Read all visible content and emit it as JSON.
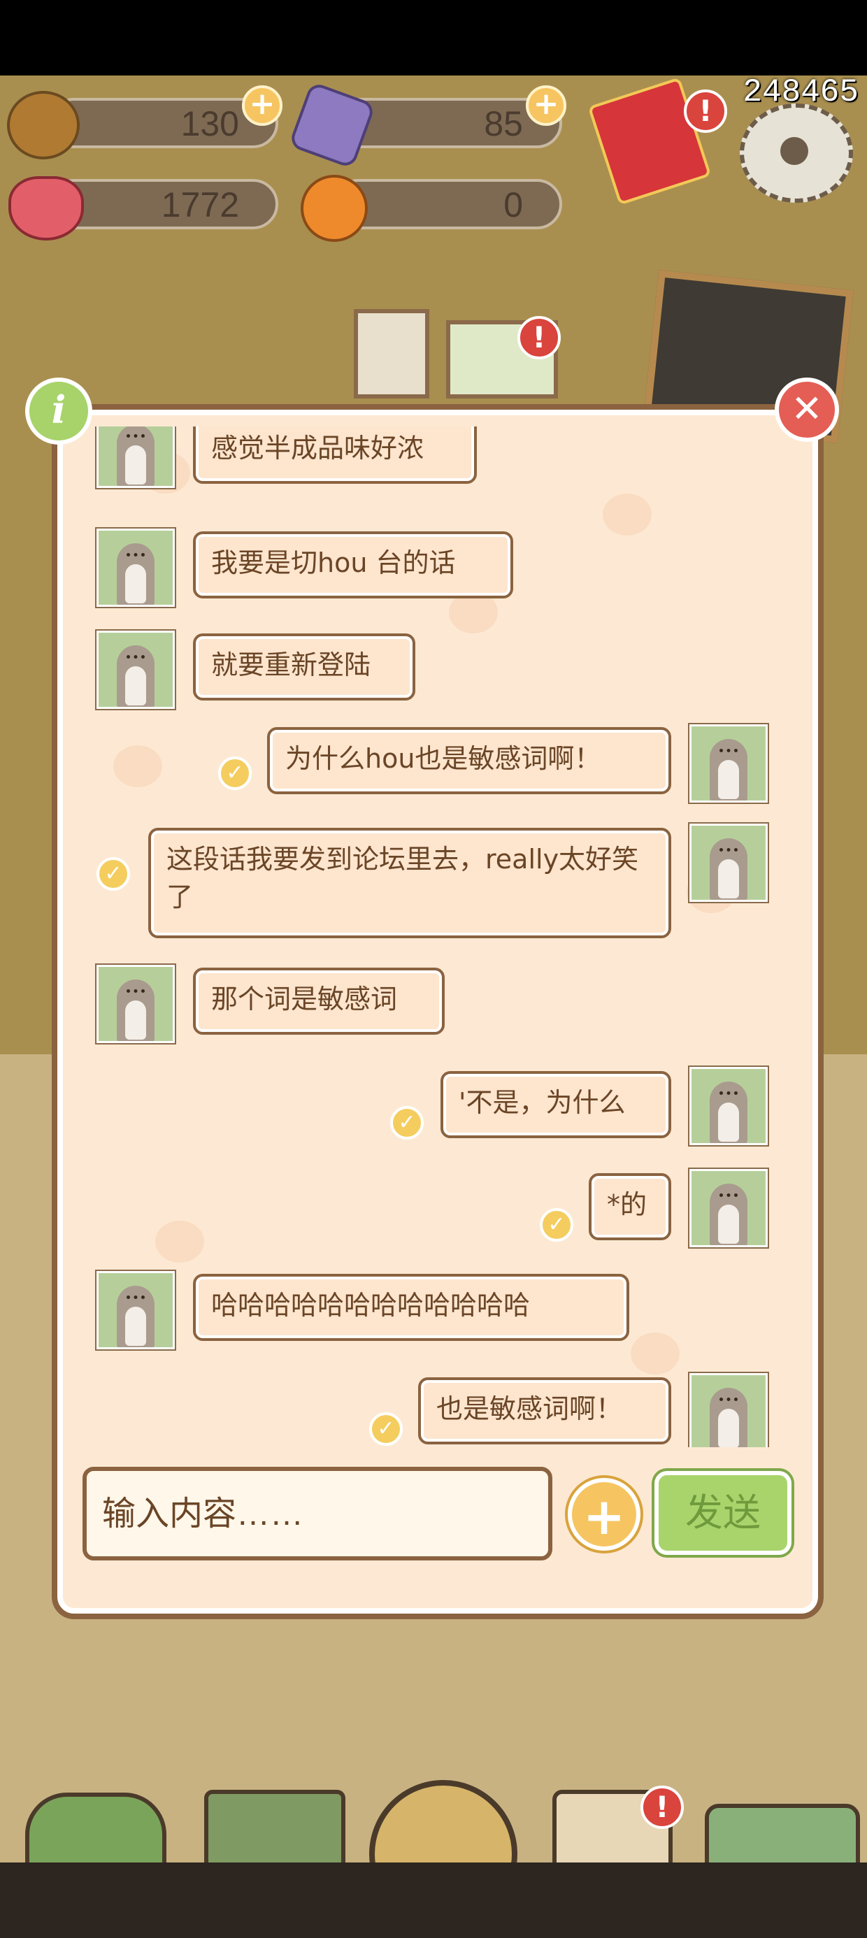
{
  "hud": {
    "acorn": "130",
    "gem": "85",
    "heart": "1772",
    "orange": "0",
    "score": "248465"
  },
  "chat": {
    "messages": [
      {
        "side": "left",
        "text": "感觉半成品味好浓",
        "read": false
      },
      {
        "side": "left",
        "text": "我要是切hou 台的话",
        "read": false
      },
      {
        "side": "left",
        "text": "就要重新登陆",
        "read": false
      },
      {
        "side": "right",
        "text": "为什么hou也是敏感词啊！",
        "read": true
      },
      {
        "side": "right",
        "text": "这段话我要发到论坛里去，really太好笑了",
        "read": true
      },
      {
        "side": "left",
        "text": "那个词是敏感词",
        "read": false
      },
      {
        "side": "right",
        "text": "'不是，为什么",
        "read": true
      },
      {
        "side": "right",
        "text": "*的",
        "read": true
      },
      {
        "side": "left",
        "text": "哈哈哈哈哈哈哈哈哈哈哈哈",
        "read": false
      },
      {
        "side": "right",
        "text": "也是敏感词啊！",
        "read": true
      }
    ]
  },
  "composer": {
    "placeholder": "输入内容……",
    "plus_icon": "plus-icon",
    "send_label": "发送"
  },
  "icons": {
    "info": "i",
    "close": "✕",
    "check": "✓",
    "plus": "+",
    "alert": "!"
  },
  "colors": {
    "panel_bg": "#fde9d3",
    "border": "#8b6340",
    "send_green": "#a9d46c",
    "accent_yellow": "#f6c561",
    "close_red": "#e45e55"
  }
}
